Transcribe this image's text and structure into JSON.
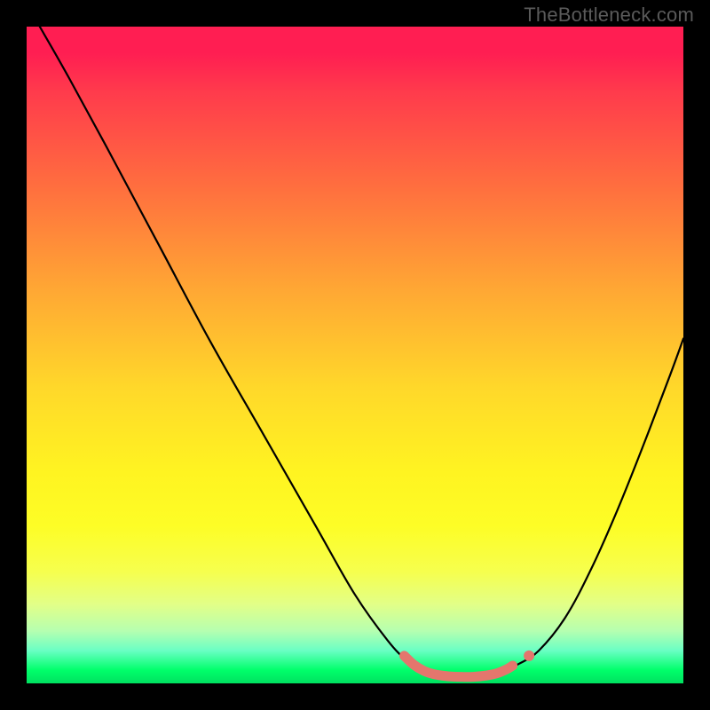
{
  "watermark": "TheBottleneck.com",
  "palette": {
    "bg": "#000000",
    "curve": "#000000",
    "accent": "#e4766d",
    "watermark": "#5a5a5a"
  },
  "chart_data": {
    "type": "line",
    "title": "",
    "xlabel": "",
    "ylabel": "",
    "xlim": [
      0,
      100
    ],
    "ylim": [
      0,
      100
    ],
    "grid": false,
    "legend": false,
    "curve_left": [
      {
        "x": 2.0,
        "y": 100.0
      },
      {
        "x": 6.0,
        "y": 93.0
      },
      {
        "x": 12.0,
        "y": 82.0
      },
      {
        "x": 20.0,
        "y": 67.0
      },
      {
        "x": 28.0,
        "y": 52.0
      },
      {
        "x": 36.0,
        "y": 38.0
      },
      {
        "x": 44.0,
        "y": 24.0
      },
      {
        "x": 50.0,
        "y": 13.5
      },
      {
        "x": 55.0,
        "y": 6.5
      },
      {
        "x": 58.0,
        "y": 3.4
      },
      {
        "x": 60.5,
        "y": 1.8
      }
    ],
    "curve_right": [
      {
        "x": 73.0,
        "y": 2.2
      },
      {
        "x": 75.0,
        "y": 3.0
      },
      {
        "x": 78.0,
        "y": 5.0
      },
      {
        "x": 82.0,
        "y": 10.0
      },
      {
        "x": 86.0,
        "y": 17.5
      },
      {
        "x": 90.0,
        "y": 26.5
      },
      {
        "x": 94.0,
        "y": 36.5
      },
      {
        "x": 98.0,
        "y": 47.0
      },
      {
        "x": 100.0,
        "y": 52.5
      }
    ],
    "accent_points": [
      {
        "x": 57.5,
        "y": 4.2
      },
      {
        "x": 59.0,
        "y": 2.8
      },
      {
        "x": 60.5,
        "y": 1.9
      },
      {
        "x": 62.0,
        "y": 1.4
      },
      {
        "x": 64.0,
        "y": 1.1
      },
      {
        "x": 66.0,
        "y": 1.0
      },
      {
        "x": 68.0,
        "y": 1.0
      },
      {
        "x": 70.0,
        "y": 1.2
      },
      {
        "x": 71.5,
        "y": 1.5
      },
      {
        "x": 73.0,
        "y": 2.1
      },
      {
        "x": 74.0,
        "y": 2.7
      }
    ],
    "accent_isolated": [
      {
        "x": 76.5,
        "y": 4.2
      }
    ]
  }
}
